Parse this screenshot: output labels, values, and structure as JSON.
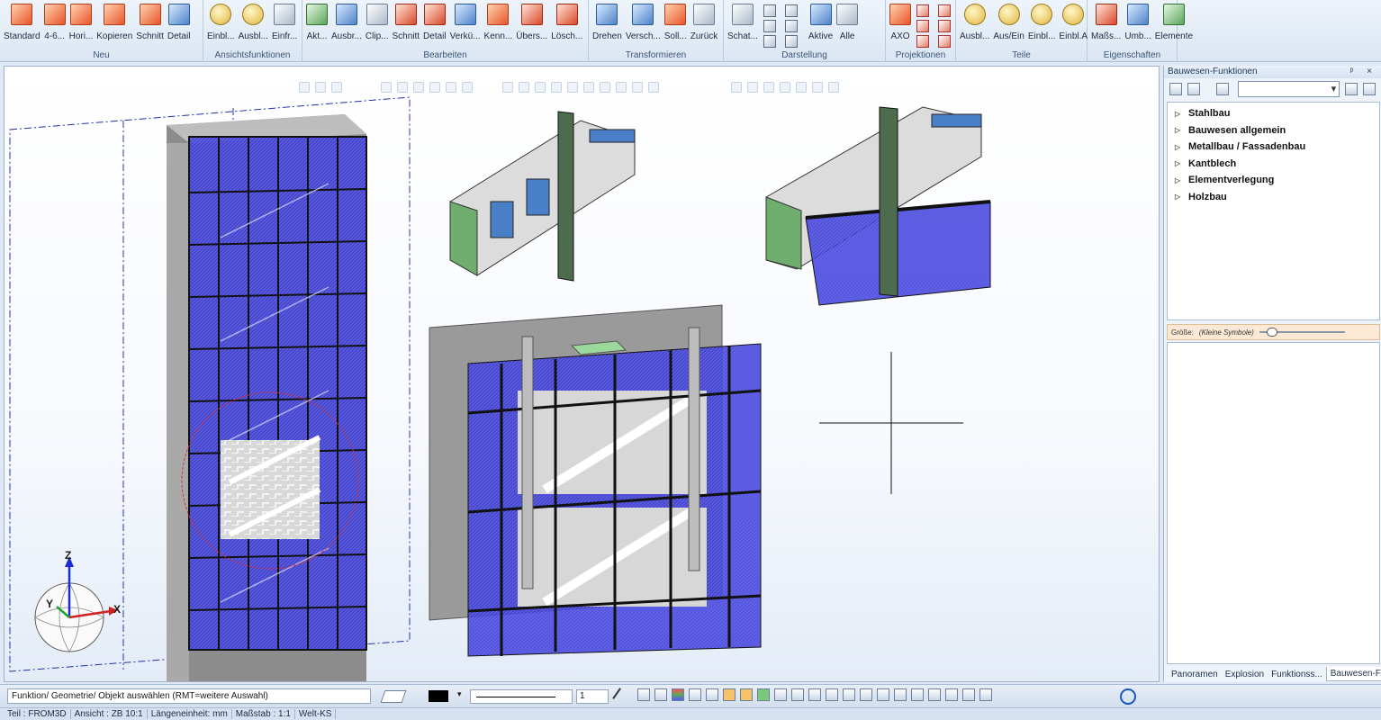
{
  "ribbon": {
    "groups": [
      {
        "title": "Neu",
        "buttons": [
          {
            "label": "Standard",
            "icon": "cube-icon",
            "color": "orange"
          },
          {
            "label": "4-6...",
            "icon": "multi-cube-icon",
            "color": "orange"
          },
          {
            "label": "Hori...",
            "icon": "horizontal-icon",
            "color": "orange"
          },
          {
            "label": "Kopieren",
            "icon": "copy-icon",
            "color": "orange"
          },
          {
            "label": "Schnitt",
            "icon": "section-icon",
            "color": "orange"
          },
          {
            "label": "Detail",
            "icon": "detail-icon",
            "color": "blue"
          }
        ]
      },
      {
        "title": "Ansichtsfunktionen",
        "buttons": [
          {
            "label": "Einbl...",
            "icon": "bulb-show-icon",
            "color": "yellow"
          },
          {
            "label": "Ausbl...",
            "icon": "bulb-hide-icon",
            "color": "yellow"
          },
          {
            "label": "Einfr...",
            "icon": "freeze-icon",
            "color": "grey"
          }
        ]
      },
      {
        "title": "Bearbeiten",
        "buttons": [
          {
            "label": "Akt...",
            "icon": "activate-icon",
            "color": "green"
          },
          {
            "label": "Ausbr...",
            "icon": "expand-icon",
            "color": "blue"
          },
          {
            "label": "Clip...",
            "icon": "clip-icon",
            "color": "grey"
          },
          {
            "label": "Schnitt",
            "icon": "cut-icon",
            "color": "red"
          },
          {
            "label": "Detail",
            "icon": "detail-edit-icon",
            "color": "red"
          },
          {
            "label": "Verkü...",
            "icon": "shorten-icon",
            "color": "blue"
          },
          {
            "label": "Kenn...",
            "icon": "label-a-icon",
            "color": "orange"
          },
          {
            "label": "Übers...",
            "icon": "overview-a-icon",
            "color": "red"
          },
          {
            "label": "Lösch...",
            "icon": "delete-x-icon",
            "color": "red"
          }
        ]
      },
      {
        "title": "Transformieren",
        "buttons": [
          {
            "label": "Drehen",
            "icon": "rotate-icon",
            "color": "blue"
          },
          {
            "label": "Versch...",
            "icon": "move-icon",
            "color": "blue"
          },
          {
            "label": "Soll...",
            "icon": "anchor-icon",
            "color": "orange"
          },
          {
            "label": "Zurück",
            "icon": "undo-icon",
            "color": "grey"
          }
        ]
      },
      {
        "title": "Darstellung",
        "buttons": [
          {
            "label": "Schat...",
            "icon": "shade-icon",
            "color": "grey"
          },
          {
            "label": "Aktive",
            "icon": "active-icon",
            "color": "blue"
          },
          {
            "label": "Alle",
            "icon": "all-icon",
            "color": "grey"
          }
        ]
      },
      {
        "title": "Projektionen",
        "buttons": [
          {
            "label": "AXO",
            "icon": "axo-icon",
            "color": "orange"
          }
        ]
      },
      {
        "title": "Teile",
        "buttons": [
          {
            "label": "Ausbl...",
            "icon": "part-hide-icon",
            "color": "yellow"
          },
          {
            "label": "Aus/Ein",
            "icon": "part-toggle-icon",
            "color": "yellow"
          },
          {
            "label": "Einbl...",
            "icon": "part-show-icon",
            "color": "yellow"
          },
          {
            "label": "Einbl.A",
            "icon": "part-show-all-icon",
            "color": "yellow"
          }
        ]
      },
      {
        "title": "Eigenschaften",
        "buttons": [
          {
            "label": "Maßs...",
            "icon": "scale-query-icon",
            "color": "red"
          },
          {
            "label": "Umb...",
            "icon": "rename-icon",
            "color": "blue"
          },
          {
            "label": "Elemente",
            "icon": "elements-icon",
            "color": "green"
          }
        ]
      }
    ]
  },
  "panel": {
    "title": "Bauwesen-Funktionen",
    "controls": "ᵖ ×",
    "tree": [
      {
        "label": "Stahlbau"
      },
      {
        "label": "Bauwesen allgemein"
      },
      {
        "label": "Metallbau / Fassadenbau"
      },
      {
        "label": "Kantblech"
      },
      {
        "label": "Elementverlegung"
      },
      {
        "label": "Holzbau"
      }
    ],
    "size_label": "Größe:",
    "size_value": "(Kleine Symbole)",
    "tabs": [
      {
        "label": "Panoramen",
        "active": false
      },
      {
        "label": "Explosion",
        "active": false
      },
      {
        "label": "Funktionss...",
        "active": false
      },
      {
        "label": "Bauwesen-F...",
        "active": true
      }
    ]
  },
  "viewport": {
    "axis_labels": {
      "z": "Z",
      "x": "X",
      "y": "Y"
    }
  },
  "cmdbar": {
    "prompt": "Funktion/ Geometrie/ Objekt auswählen (RMT=weitere Auswahl)",
    "line_weight": "1"
  },
  "status": {
    "teil": "Teil : FROM3D",
    "ansicht": "Ansicht : ZB 10:1",
    "laengeneinheit": "Längeneinheit: mm",
    "massstab": "Maßstab : 1:1",
    "ks": "Welt-KS"
  },
  "colors": {
    "glass": "#3a3ad6",
    "concrete": "#9a9a9a",
    "frame": "#1f1f1f",
    "accent": "#d9482a"
  }
}
